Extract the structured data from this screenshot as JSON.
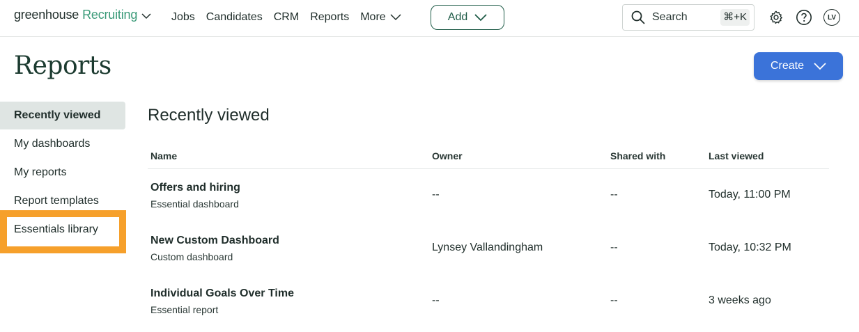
{
  "nav": {
    "brand_main": "greenhouse",
    "brand_product": "Recruiting",
    "links": [
      "Jobs",
      "Candidates",
      "CRM",
      "Reports",
      "More"
    ],
    "add_label": "Add",
    "search_label": "Search",
    "search_shortcut": "⌘+K",
    "avatar_initials": "LV",
    "icons": [
      "chevron-down-icon",
      "search-icon",
      "gear-icon",
      "help-icon"
    ]
  },
  "page": {
    "title": "Reports",
    "create_label": "Create"
  },
  "sidebar": {
    "items": [
      {
        "label": "Recently viewed",
        "active": true
      },
      {
        "label": "My dashboards",
        "active": false
      },
      {
        "label": "My reports",
        "active": false
      },
      {
        "label": "Report templates",
        "active": false
      },
      {
        "label": "Essentials library",
        "active": false,
        "highlighted": true
      }
    ]
  },
  "main": {
    "section_title": "Recently viewed",
    "columns": [
      "Name",
      "Owner",
      "Shared with",
      "Last viewed"
    ],
    "rows": [
      {
        "name": "Offers and hiring",
        "type": "Essential dashboard",
        "owner": "--",
        "shared": "--",
        "last_viewed": "Today, 11:00 PM"
      },
      {
        "name": "New Custom Dashboard",
        "type": "Custom dashboard",
        "owner": "Lynsey Vallandingham",
        "shared": "--",
        "last_viewed": "Today, 10:32 PM"
      },
      {
        "name": "Individual Goals Over Time",
        "type": "Essential report",
        "owner": "--",
        "shared": "--",
        "last_viewed": "3 weeks ago"
      }
    ]
  },
  "colors": {
    "brand_green": "#3a9a78",
    "dark_green": "#1e5b47",
    "create_blue": "#3b73d9",
    "highlight_orange": "#f6a02b",
    "active_bg": "#dfe5e3"
  }
}
